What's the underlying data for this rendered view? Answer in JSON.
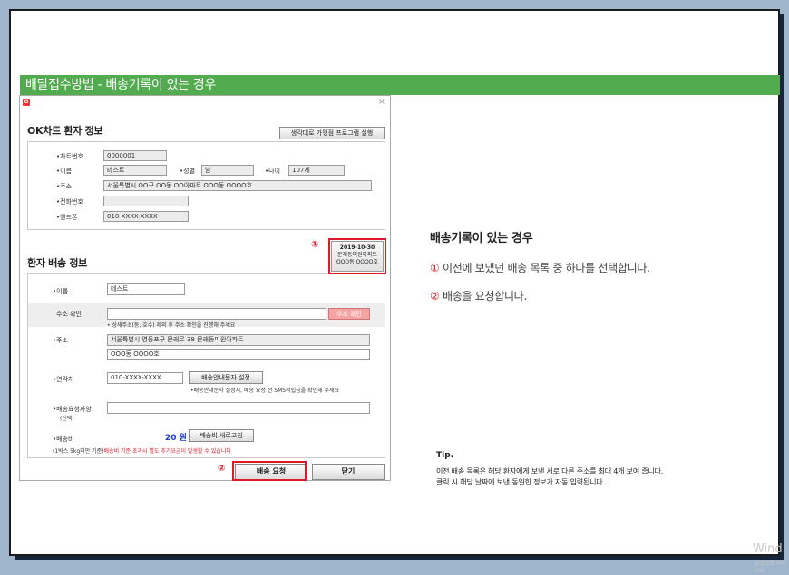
{
  "banner_title": "배달접수방법 - 배송기록이 있는 경우",
  "dialog": {
    "icon_letter": "O",
    "close": "×",
    "patient_section": {
      "title": "OK차트 환자 정보",
      "launch_button": "생각대로 가맹점 프로그램 실행",
      "labels": {
        "chart_no": "•차트번호",
        "name": "•이름",
        "gender": "•성별",
        "age": "•나이",
        "address": "•주소",
        "phone": "•전화번호",
        "mobile": "•핸드폰"
      },
      "values": {
        "chart_no": "0000001",
        "name": "테스트",
        "gender": "남",
        "age": "107세",
        "address": "서울특별시 OO구 OO동 OO아파트 OOO동 OOOO호",
        "phone": "",
        "mobile": "010-XXXX-XXXX"
      }
    },
    "history_button": {
      "date": "2019-10-30",
      "line2": "문래동미원아파트",
      "line3": "OOO동 OOOO호"
    },
    "delivery_section": {
      "title": "환자 배송 정보",
      "labels": {
        "name": "•이름",
        "address_check": "주소 확인",
        "address": "•주소",
        "contact": "•연락처",
        "request": "•배송요청사항",
        "request_sub": "(선택)",
        "fee": "•배송비"
      },
      "name_value": "테스트",
      "address_check_value": "",
      "address_check_button": "주소 확인",
      "address_note": "• 상세주소(동, 호수) 제외 후 주소 확인을 진행해 주세요",
      "address_line1": "서울특별시 영등포구 문래로 38 문래동미원아파트",
      "address_line2": "OOO동 OOOO호",
      "contact_value": "010-XXXX-XXXX",
      "sms_button": "배송안내문자 설정",
      "sms_note": "•배송안내문자 설정시, 배송 요청 전 SMS적립금을 확인해 주세요",
      "request_value": "",
      "fee_value": "20 원",
      "fee_refresh_button": "배송비 새로고침",
      "fee_note_black": "(1박스 5kg미만 기준)",
      "fee_note_red": "배송비 기준 초과시 별도 추가요금이 발생할 수 있습니다",
      "request_button": "배송 요청",
      "close_button": "닫기"
    }
  },
  "markers": {
    "one": "①",
    "two": "②"
  },
  "panel": {
    "title": "배송기록이 있는 경우",
    "step1_num": "①",
    "step1_text": " 이전에 보냈던 배송 목록 중 하나를 선택합니다.",
    "step2_num": "②",
    "step2_text": " 배송을 요청합니다."
  },
  "tip": {
    "title": "Tip.",
    "line1": "이전 배송 목록은 해당 환자에게 보낸 서로 다른 주소를 최대 4개 보여 줍니다.",
    "line2": "클릭 시 해당 날짜에 보낸 동일한 정보가 자동 입력됩니다."
  },
  "watermark": "Wind",
  "watermark_sub": "설정으로 이동하여"
}
